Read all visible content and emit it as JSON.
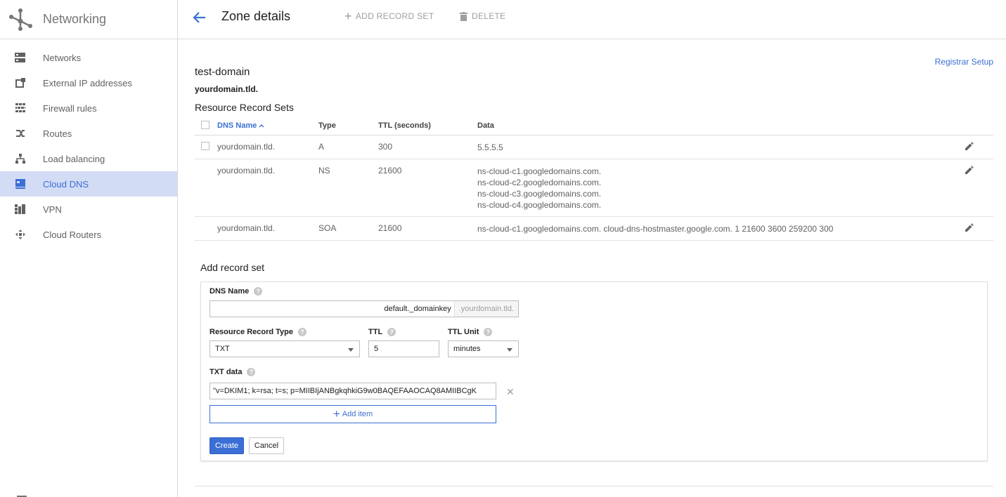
{
  "sidebar": {
    "title": "Networking",
    "items": [
      {
        "label": "Networks",
        "icon": "networks-icon"
      },
      {
        "label": "External IP addresses",
        "icon": "external-ip-icon"
      },
      {
        "label": "Firewall rules",
        "icon": "firewall-icon"
      },
      {
        "label": "Routes",
        "icon": "routes-icon"
      },
      {
        "label": "Load balancing",
        "icon": "load-balancing-icon"
      },
      {
        "label": "Cloud DNS",
        "icon": "cloud-dns-icon",
        "active": true
      },
      {
        "label": "VPN",
        "icon": "vpn-icon"
      },
      {
        "label": "Cloud Routers",
        "icon": "cloud-routers-icon"
      }
    ]
  },
  "header": {
    "title": "Zone details",
    "add_record_set": "ADD RECORD SET",
    "delete": "DELETE"
  },
  "zone": {
    "registrar_link": "Registrar Setup",
    "name": "test-domain",
    "domain": "yourdomain.tld.",
    "section_title": "Resource Record Sets"
  },
  "table": {
    "columns": {
      "dns_name": "DNS Name",
      "type": "Type",
      "ttl": "TTL (seconds)",
      "data": "Data"
    },
    "rows": [
      {
        "dns_name": "yourdomain.tld.",
        "type": "A",
        "ttl": "300",
        "data": [
          "5.5.5.5"
        ]
      },
      {
        "dns_name": "yourdomain.tld.",
        "type": "NS",
        "ttl": "21600",
        "data": [
          "ns-cloud-c1.googledomains.com.",
          "ns-cloud-c2.googledomains.com.",
          "ns-cloud-c3.googledomains.com.",
          "ns-cloud-c4.googledomains.com."
        ]
      },
      {
        "dns_name": "yourdomain.tld.",
        "type": "SOA",
        "ttl": "21600",
        "data": [
          "ns-cloud-c1.googledomains.com. cloud-dns-hostmaster.google.com. 1 21600 3600 259200 300"
        ]
      }
    ]
  },
  "add_form": {
    "title": "Add record set",
    "dns_name_label": "DNS Name",
    "dns_name_value": "default._domainkey",
    "dns_name_suffix": ".yourdomain.tld.",
    "rr_type_label": "Resource Record Type",
    "rr_type_value": "TXT",
    "ttl_label": "TTL",
    "ttl_value": "5",
    "ttl_unit_label": "TTL Unit",
    "ttl_unit_value": "minutes",
    "txt_data_label": "TXT data",
    "txt_data_value": "\"v=DKIM1; k=rsa; t=s; p=MIIBIjANBgkqhkiG9w0BAQEFAAOCAQ8AMIIBCgK",
    "add_item": "Add item",
    "create": "Create",
    "cancel": "Cancel"
  },
  "colors": {
    "accent": "#3b6fd5",
    "active_bg": "#d3dcf5"
  }
}
